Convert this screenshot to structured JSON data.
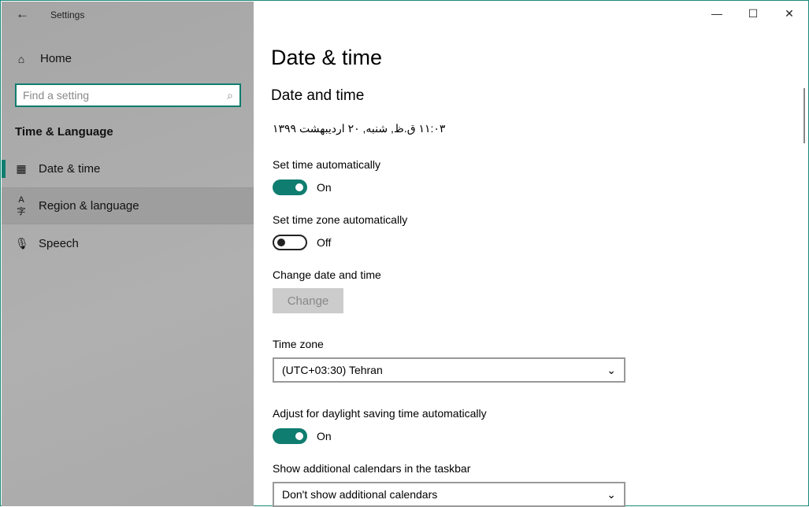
{
  "window": {
    "title": "Settings",
    "accent": "#0f7d6f"
  },
  "sidebar": {
    "home": "Home",
    "search_placeholder": "Find a setting",
    "section": "Time & Language",
    "items": [
      {
        "label": "Date & time",
        "icon": "calendar-clock-icon"
      },
      {
        "label": "Region & language",
        "icon": "language-icon"
      },
      {
        "label": "Speech",
        "icon": "microphone-icon"
      }
    ]
  },
  "main": {
    "title": "Date & time",
    "subtitle": "Date and time",
    "current_datetime": "۱۱:۰۳ ق.ظ, شنبه, ۲۰ اردیبهشت ۱۳۹۹",
    "set_time_auto": {
      "label": "Set time automatically",
      "state": "On"
    },
    "set_tz_auto": {
      "label": "Set time zone automatically",
      "state": "Off"
    },
    "change": {
      "label": "Change date and time",
      "button": "Change"
    },
    "timezone": {
      "label": "Time zone",
      "value": "(UTC+03:30) Tehran"
    },
    "dst": {
      "label": "Adjust for daylight saving time automatically",
      "state": "On"
    },
    "calendars": {
      "label": "Show additional calendars in the taskbar",
      "value": "Don't show additional calendars"
    }
  }
}
